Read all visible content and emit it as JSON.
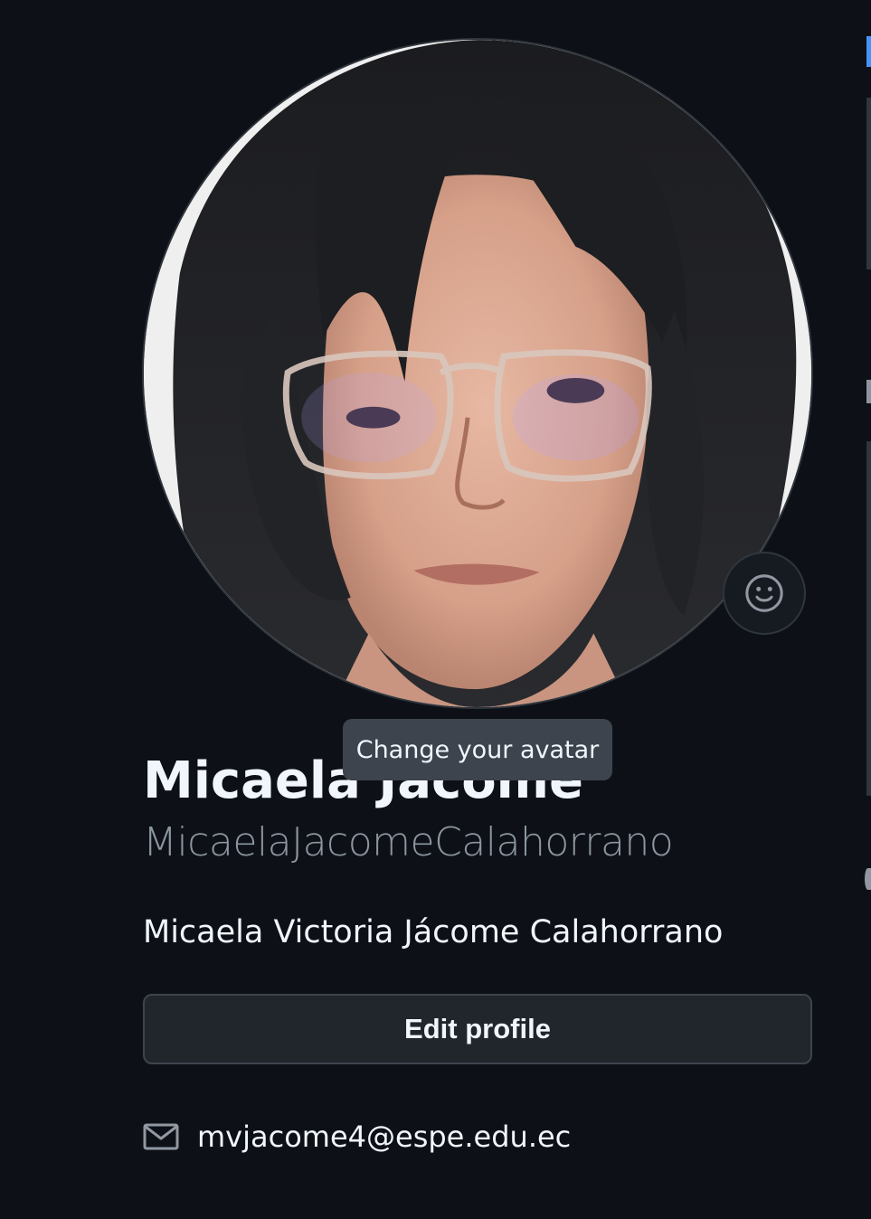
{
  "profile": {
    "name": "Micaela Jacome",
    "username": "MicaelaJacomeCalahorrano",
    "bio": "Micaela Victoria Jácome Calahorrano",
    "email": "mvjacome4@espe.edu.ec"
  },
  "avatar": {
    "tooltip": "Change your avatar",
    "status_icon": "smiley-icon"
  },
  "actions": {
    "edit_profile": "Edit profile"
  },
  "colors": {
    "background": "#0d1117",
    "button_bg": "#21262d",
    "border": "#30363d",
    "muted_text": "#8d96a0",
    "primary_text": "#f0f6fc"
  }
}
